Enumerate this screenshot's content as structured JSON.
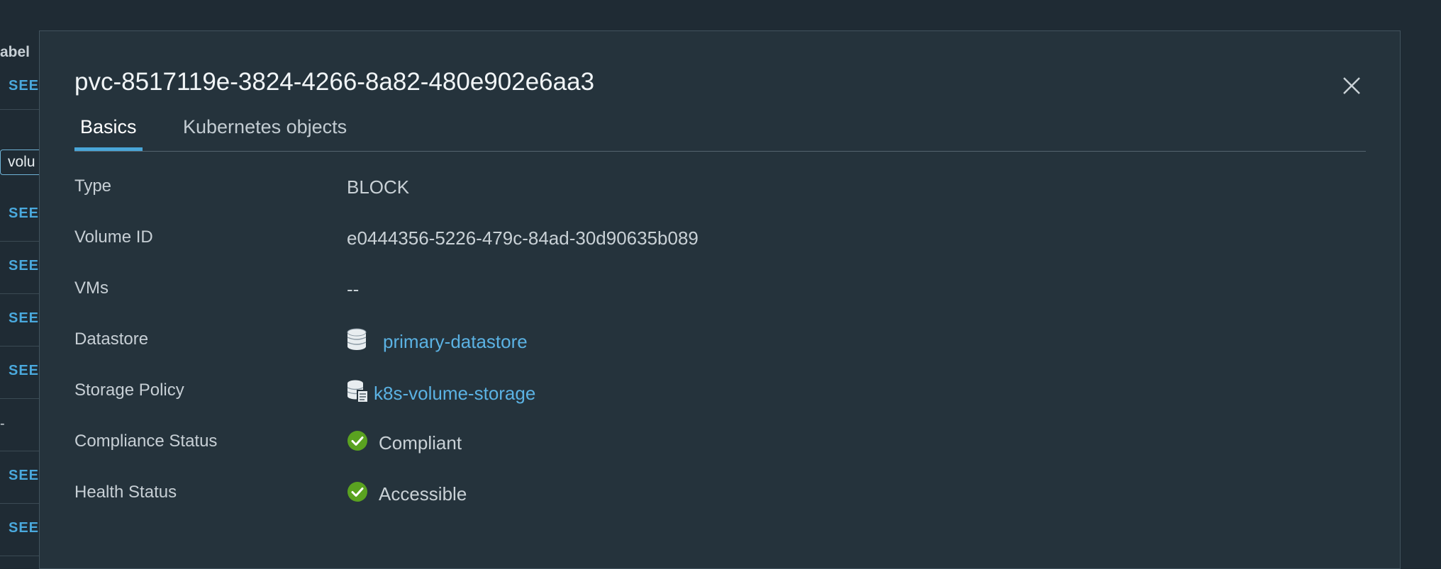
{
  "background": {
    "header": "abel",
    "see_label": "SEE",
    "input_value": "volu",
    "dash": "-"
  },
  "modal": {
    "title": "pvc-8517119e-3824-4266-8a82-480e902e6aa3",
    "close_icon": "close-icon",
    "tabs": [
      {
        "label": "Basics",
        "active": true
      },
      {
        "label": "Kubernetes objects",
        "active": false
      }
    ],
    "properties": {
      "type": {
        "label": "Type",
        "value": "BLOCK"
      },
      "volume_id": {
        "label": "Volume ID",
        "value": "e0444356-5226-479c-84ad-30d90635b089"
      },
      "vms": {
        "label": "VMs",
        "value": "--"
      },
      "datastore": {
        "label": "Datastore",
        "value": "primary-datastore",
        "icon": "database-icon"
      },
      "storage_policy": {
        "label": "Storage Policy",
        "value": "k8s-volume-storage",
        "icon": "storage-policy-icon"
      },
      "compliance_status": {
        "label": "Compliance Status",
        "value": "Compliant",
        "icon": "check-circle-icon"
      },
      "health_status": {
        "label": "Health Status",
        "value": "Accessible",
        "icon": "check-circle-icon"
      }
    }
  },
  "colors": {
    "link": "#5bb2e3",
    "success": "#5aa220",
    "tab_active": "#49a6d8"
  }
}
